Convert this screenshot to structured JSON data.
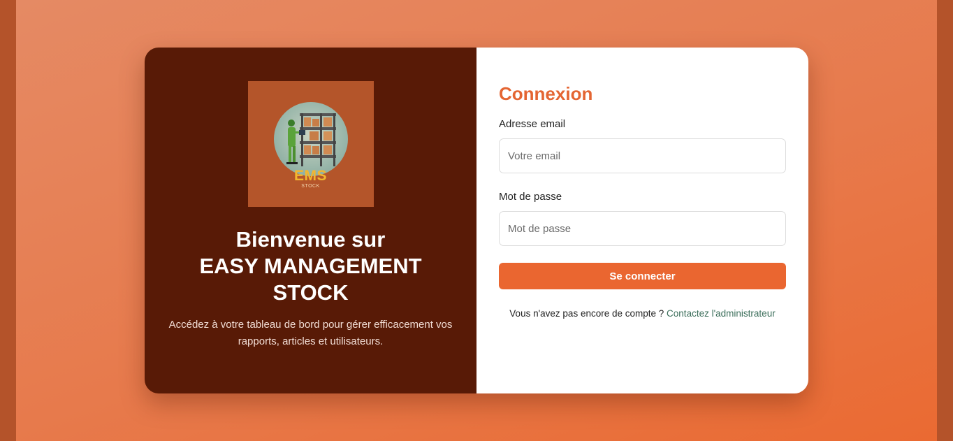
{
  "colors": {
    "accent": "#ea6630",
    "left_panel": "#581a06",
    "logo_bg": "#b4552a",
    "logo_text": "#f3b62f",
    "link": "#3b6e5a"
  },
  "logo": {
    "title": "EMS",
    "subtitle": "STOCK",
    "icon": "warehouse-worker-icon"
  },
  "welcome": {
    "line1": "Bienvenue sur",
    "line2": "EASY MANAGEMENT",
    "line3": "STOCK",
    "tagline": "Accédez à votre tableau de bord pour gérer efficacement vos rapports, articles et utilisateurs."
  },
  "form": {
    "title": "Connexion",
    "email_label": "Adresse email",
    "email_placeholder": "Votre email",
    "email_value": "",
    "password_label": "Mot de passe",
    "password_placeholder": "Mot de passe",
    "password_value": "",
    "submit_label": "Se connecter",
    "signup_text": "Vous n'avez pas encore de compte ?",
    "signup_link": "Contactez l'administrateur"
  }
}
